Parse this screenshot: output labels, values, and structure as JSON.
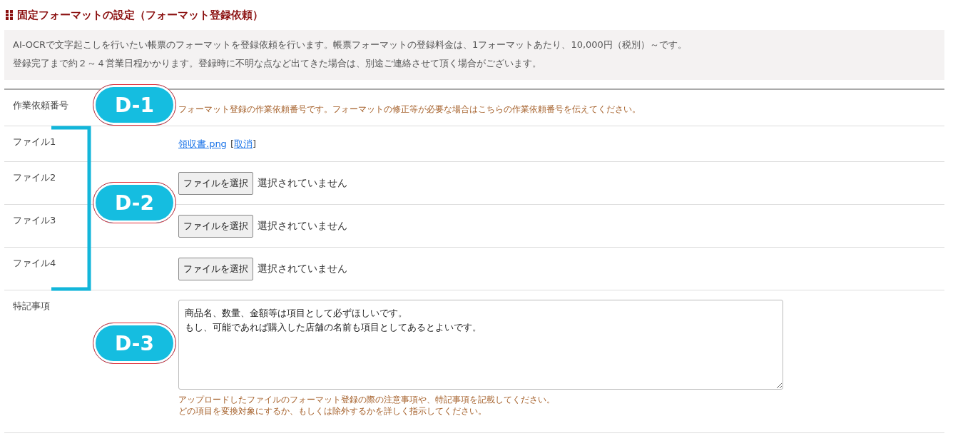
{
  "title": "固定フォーマットの設定（フォーマット登録依頼）",
  "intro": [
    "AI-OCRで文字起こしを行いたい帳票のフォーマットを登録依頼を行います。帳票フォーマットの登録料金は、1フォーマットあたり、10,000円（税別）～です。",
    "登録完了まで約２～４営業日程かかります。登録時に不明な点など出てきた場合は、別途ご連絡させて頂く場合がございます。"
  ],
  "rows": [
    {
      "kind": "note",
      "label": "作業依頼番号",
      "hint": [
        "フォーマット登録の作業依頼番号です。フォーマットの修正等が必要な場合はこちらの作業依頼番号を伝えてください。"
      ]
    },
    {
      "kind": "file_link",
      "label": "ファイル1",
      "filename": "領収書.png",
      "cancel_open": "[",
      "cancel": "取消",
      "cancel_close": "]"
    },
    {
      "kind": "file_input",
      "label": "ファイル2",
      "button": "ファイルを選択",
      "status": "選択されていません"
    },
    {
      "kind": "file_input",
      "label": "ファイル3",
      "button": "ファイルを選択",
      "status": "選択されていません"
    },
    {
      "kind": "file_input",
      "label": "ファイル4",
      "button": "ファイルを選択",
      "status": "選択されていません"
    },
    {
      "kind": "textarea",
      "label": "特記事項",
      "value": [
        "商品名、数量、金額等は項目として必ずほしいです。",
        "もし、可能であれば購入した店舗の名前も項目としてあるとよいです。"
      ],
      "hint": [
        "アップロードしたファイルのフォーマット登録の際の注意事項や、特記事項を記載してください。",
        "どの項目を変換対象にするか、もしくは除外するかを詳しく指示してください。"
      ]
    }
  ],
  "annotations": [
    {
      "label": "D-1"
    },
    {
      "label": "D-2"
    },
    {
      "label": "D-3"
    }
  ]
}
